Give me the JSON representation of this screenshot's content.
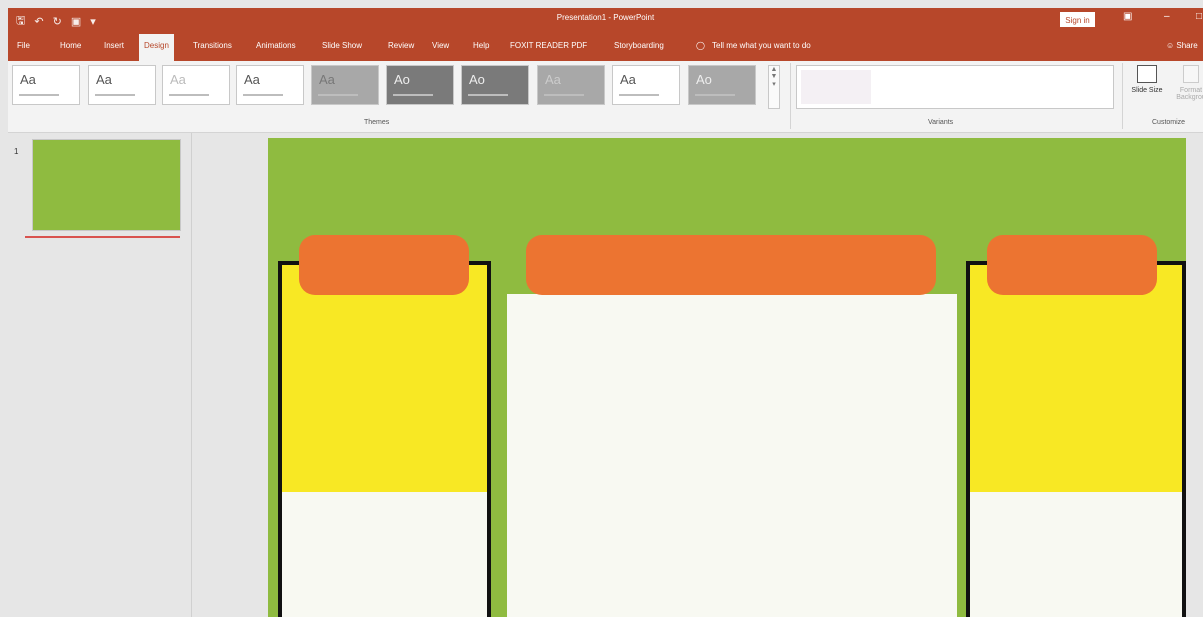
{
  "titlebar": {
    "title": "Presentation1 - PowerPoint",
    "sign_in": "Sign in",
    "qat": {
      "save_icon": "save-icon",
      "undo_icon": "undo-icon",
      "redo_icon": "redo-icon",
      "customize_icon": "start-from-beginning-icon",
      "more_icon": "dropdown-icon"
    }
  },
  "tabs": {
    "file": "File",
    "home": "Home",
    "insert": "Insert",
    "design": "Design",
    "transitions": "Transitions",
    "animations": "Animations",
    "slide_show": "Slide Show",
    "review": "Review",
    "view": "View",
    "help": "Help",
    "foxit": "FOXIT READER PDF",
    "storyboarding": "Storyboarding",
    "tell_me": "Tell me what you want to do",
    "share": "Share"
  },
  "ribbon": {
    "themes_label": "Themes",
    "variants_label": "Variants",
    "customize_label": "Customize",
    "slide_size_label": "Slide Size",
    "format_bg_label": "Format Backgrou",
    "theme_aa": "Aa",
    "theme_ao": "Ao"
  },
  "thumbnails": {
    "slide_number": "1"
  },
  "colors": {
    "accent": "#b7472a",
    "slide_bg": "#8fbb40",
    "orange": "#ec7431",
    "yellow": "#f8e824",
    "panel": "#f8f9f2"
  }
}
